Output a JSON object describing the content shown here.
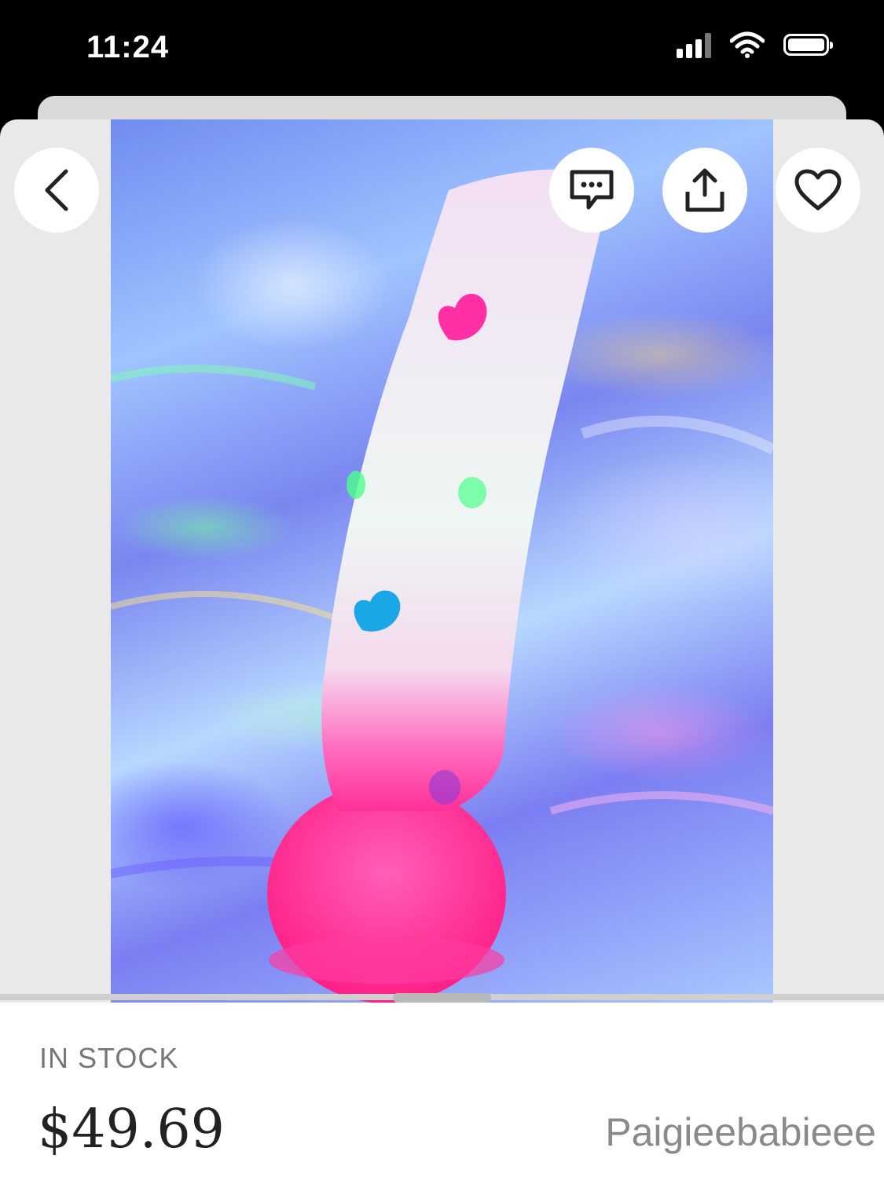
{
  "status_bar": {
    "time": "11:24"
  },
  "product": {
    "stock_status": "IN STOCK",
    "price": "$49.69",
    "seller": "Paigieebabieee"
  },
  "icons": {
    "back": "chevron-left-icon",
    "chat": "chat-bubble-icon",
    "share": "share-icon",
    "favorite": "heart-icon"
  },
  "colors": {
    "accent_pink": "#ff2f9a",
    "text_gray": "#777777"
  }
}
